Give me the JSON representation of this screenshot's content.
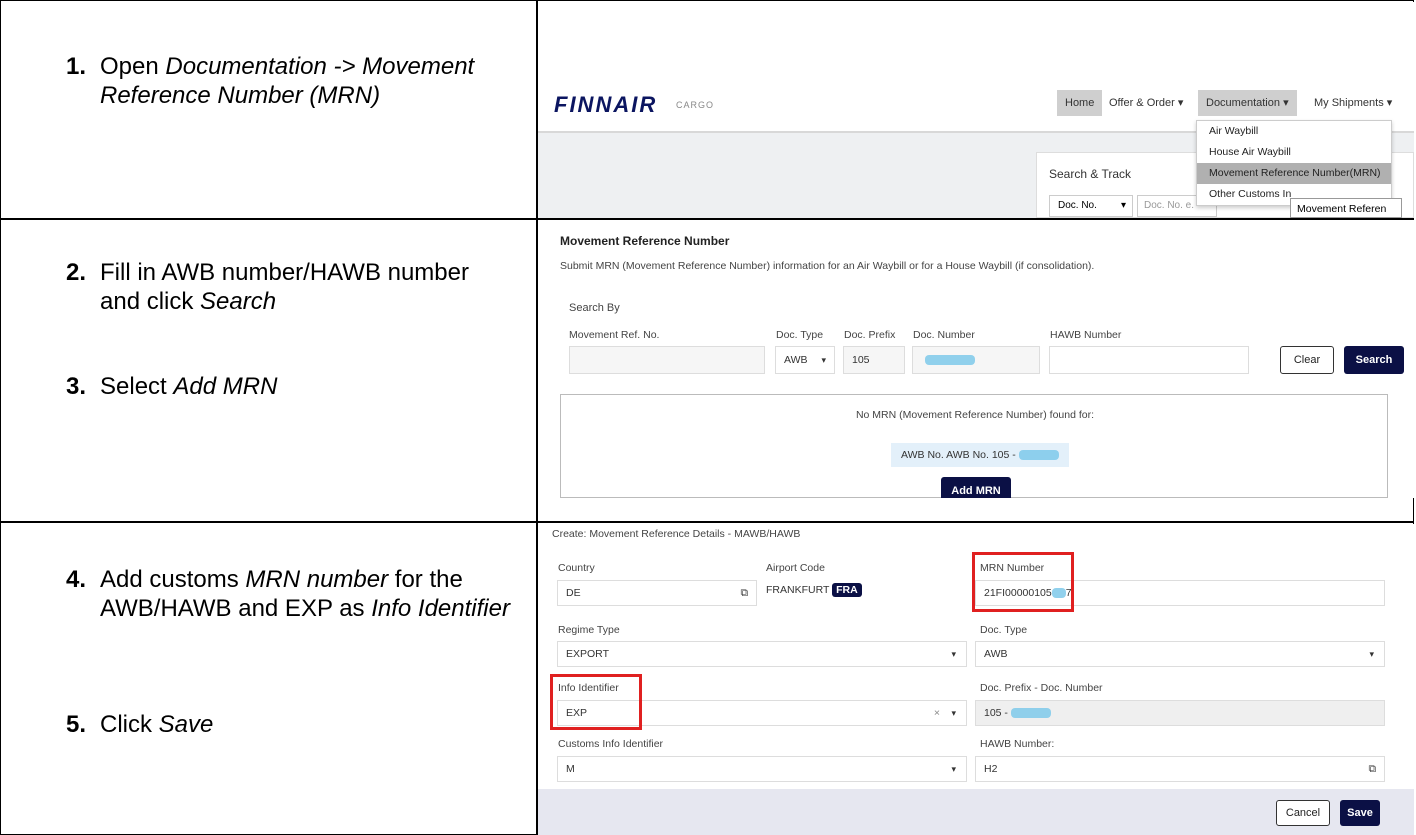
{
  "steps": {
    "s1": {
      "num": "1.",
      "pre": "Open ",
      "em": "Documentation -> Movement Reference Number (MRN)"
    },
    "s2": {
      "num": "2.",
      "pre": "Fill in AWB number/HAWB number and click ",
      "em": "Search"
    },
    "s3": {
      "num": "3.",
      "pre": "Select ",
      "em": "Add MRN"
    },
    "s4": {
      "num": "4.",
      "pre": "Add customs ",
      "em": "MRN number",
      "mid": " for the AWB/HAWB and EXP as ",
      "em2": "Info Identifier"
    },
    "s5": {
      "num": "5.",
      "pre": "Click ",
      "em": "Save"
    }
  },
  "panel1": {
    "logo": "FINNAIR",
    "logo_sub": "CARGO",
    "nav": {
      "home": "Home",
      "offer": "Offer & Order",
      "documentation": "Documentation",
      "shipments": "My Shipments"
    },
    "menu": [
      "Air Waybill",
      "House Air Waybill",
      "Movement Reference Number(MRN)",
      "Other Customs In"
    ],
    "tooltip": "Movement Referen",
    "search_title": "Search & Track",
    "doc_select": "Doc. No.",
    "doc_placeholder": "Doc. No. e."
  },
  "panel2": {
    "title": "Movement Reference Number",
    "subtitle": "Submit MRN (Movement Reference Number) information for an Air Waybill or for a House Waybill (if consolidation).",
    "search_by": "Search By",
    "labels": {
      "mrn": "Movement Ref. No.",
      "doc_type": "Doc. Type",
      "doc_prefix": "Doc. Prefix",
      "doc_number": "Doc. Number",
      "hawb": "HAWB Number"
    },
    "values": {
      "doc_type": "AWB",
      "doc_prefix": "105"
    },
    "clear": "Clear",
    "search": "Search",
    "no_result": "No MRN (Movement Reference Number) found for:",
    "result_pill": "AWB No. AWB No. 105 -",
    "add_mrn": "Add MRN"
  },
  "panel3": {
    "header": "Create: Movement Reference Details - MAWB/HAWB",
    "labels": {
      "country": "Country",
      "airport": "Airport Code",
      "mrn": "MRN Number",
      "regime": "Regime Type",
      "doc_type": "Doc. Type",
      "info": "Info Identifier",
      "prefix_number": "Doc. Prefix - Doc. Number",
      "customs": "Customs Info Identifier",
      "hawb": "HAWB Number:"
    },
    "values": {
      "country": "DE",
      "airport": "FRANKFURT",
      "airport_code": "FRA",
      "mrn": "21FI00000105",
      "mrn_tail": "7",
      "regime": "EXPORT",
      "doc_type": "AWB",
      "info": "EXP",
      "prefix_number": "105 -",
      "customs": "M",
      "hawb": "H2"
    },
    "cancel": "Cancel",
    "save": "Save"
  }
}
